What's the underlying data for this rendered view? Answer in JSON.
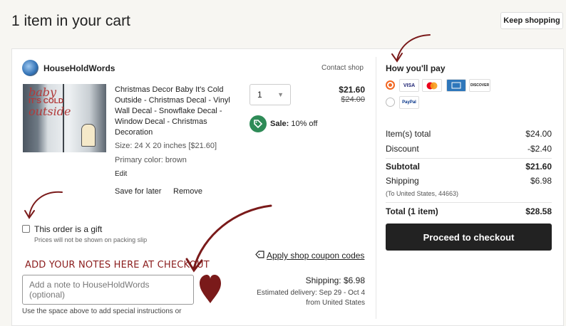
{
  "header": {
    "title": "1 item in your cart",
    "keep_shopping": "Keep shopping"
  },
  "shop": {
    "name": "HouseHoldWords",
    "contact": "Contact shop"
  },
  "item": {
    "title": "Christmas Decor Baby It's Cold Outside - Christmas Decal - Vinyl Wall Decal - Snowflake Decal - Window Decal - Christmas Decoration",
    "size": "Size: 24 X 20 inches [$21.60]",
    "color": "Primary color: brown",
    "edit": "Edit",
    "save_for_later": "Save for later",
    "remove": "Remove",
    "quantity": "1",
    "price": "$21.60",
    "original_price": "$24.00",
    "sale_label": "Sale:",
    "sale_value": "10% off",
    "thumb_lettering_1": "baby",
    "thumb_lettering_2": "IT'S COLD",
    "thumb_lettering_3": "outside"
  },
  "gift": {
    "label": "This order is a gift",
    "note": "Prices will not be shown on packing slip"
  },
  "coupon": "Apply shop coupon codes",
  "notes": {
    "heading": "ADD YOUR NOTES HERE AT CHECKOUT",
    "placeholder": "Add a note to HouseHoldWords (optional)",
    "help": "Use the space above to add special instructions or"
  },
  "shipping": {
    "cost": "Shipping: $6.98",
    "estimate": "Estimated delivery: Sep 29 - Oct 4",
    "origin": "from United States"
  },
  "payment": {
    "heading": "How you'll pay",
    "cards": [
      "VISA",
      "MC",
      "AMEX",
      "DISCOVER"
    ],
    "paypal": "PayPal"
  },
  "summary": {
    "items_total_label": "Item(s) total",
    "items_total": "$24.00",
    "discount_label": "Discount",
    "discount": "-$2.40",
    "subtotal_label": "Subtotal",
    "subtotal": "$21.60",
    "shipping_label": "Shipping",
    "shipping": "$6.98",
    "shipping_dest": "(To United States, 44663)",
    "total_label": "Total (1 item)",
    "total": "$28.58",
    "checkout": "Proceed to checkout"
  },
  "colors": {
    "accent": "#f26722",
    "sale": "#2e8b57",
    "annotation": "#7a1a1a",
    "button": "#222222"
  }
}
